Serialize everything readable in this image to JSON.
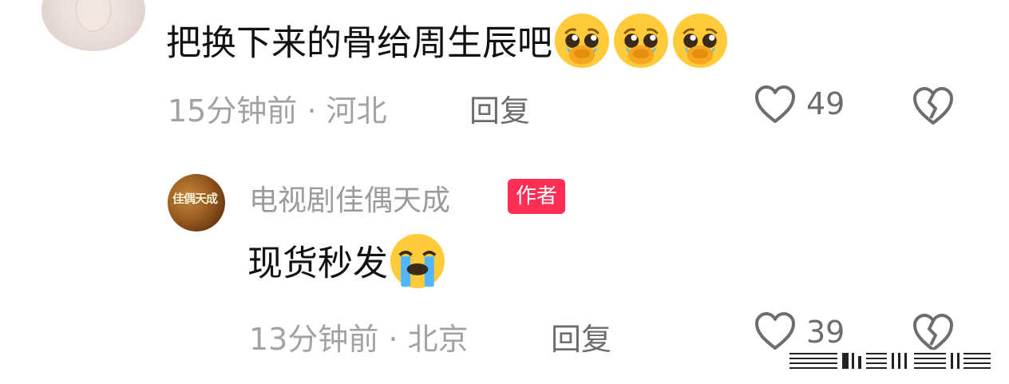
{
  "comment": {
    "text": "把换下来的骨给周生辰吧",
    "emoji": [
      "pleading-face-icon",
      "pleading-face-icon",
      "pleading-face-icon"
    ],
    "time": "15分钟前",
    "dot": "·",
    "location": "河北",
    "reply_label": "回复",
    "likes": "49"
  },
  "reply": {
    "username": "电视剧佳偶天成",
    "badge": "作者",
    "avatar_text": "佳偶天成",
    "text": "现货秒发",
    "emoji": "loudly-crying-face-icon",
    "time": "13分钟前",
    "dot": "·",
    "location": "北京",
    "reply_label": "回复",
    "likes": "39"
  },
  "colors": {
    "badge": "#ff2e55",
    "text_primary": "#111111",
    "text_muted": "#a2a2a2",
    "icon": "#6d6d6d"
  }
}
